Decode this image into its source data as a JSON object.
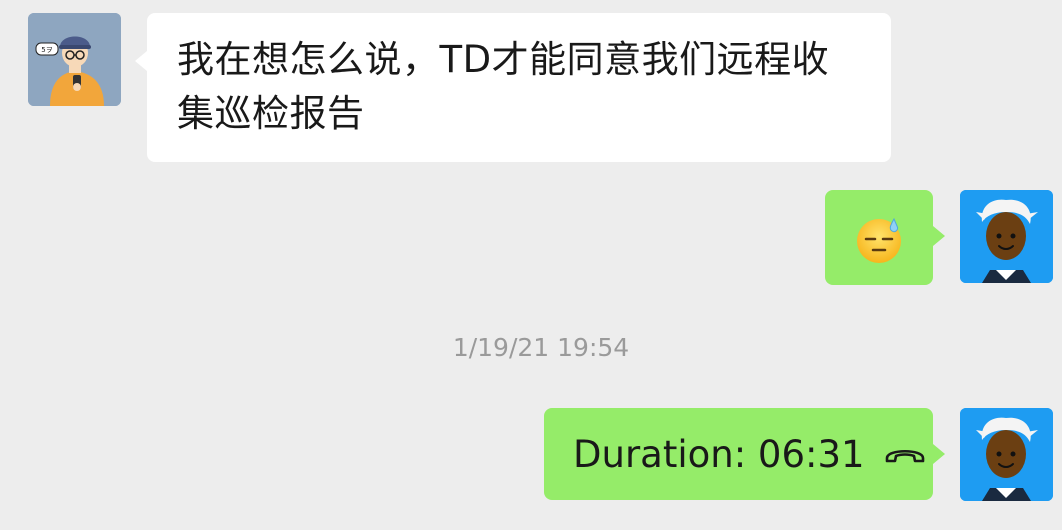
{
  "conversation": {
    "incoming_message": {
      "text": "我在想怎么说，TD才能同意我们远程收集巡检报告"
    },
    "outgoing_emoji": {
      "emoji": "downcast-face-with-sweat"
    },
    "timestamp": "1/19/21 19:54",
    "call_record": {
      "text": "Duration: 06:31",
      "icon": "hang-up-phone-icon"
    }
  },
  "colors": {
    "background": "#ededed",
    "incoming_bubble": "#ffffff",
    "outgoing_bubble": "#95ec69",
    "timestamp_text": "#9a9a9a",
    "self_avatar_bg": "#1e9cf2",
    "contact_avatar_bg": "#8ea6c0"
  }
}
